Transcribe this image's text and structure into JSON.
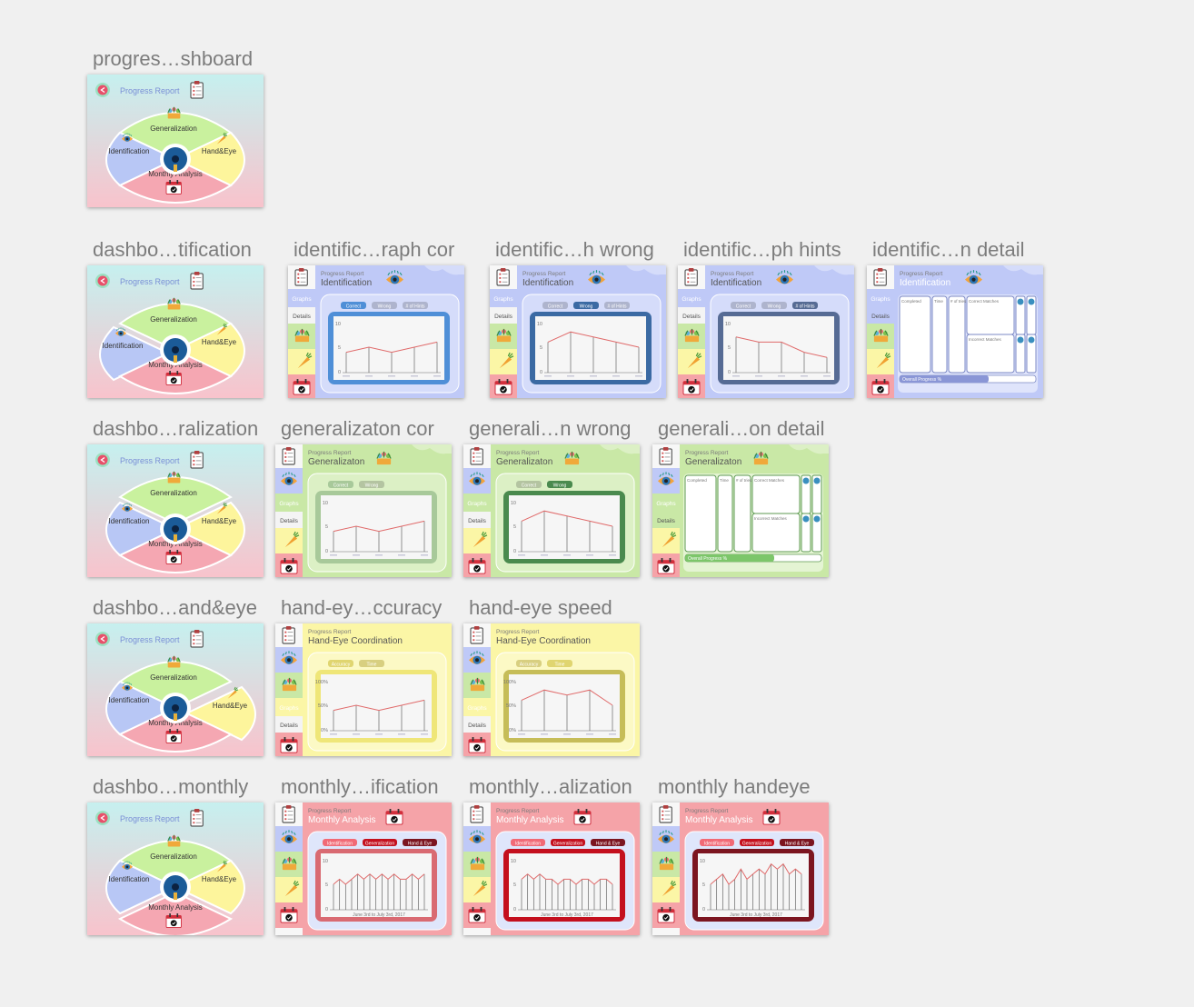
{
  "canvas_background": "#f0f0f0",
  "common": {
    "progress_report": "Progress Report",
    "graphs": "Graphs",
    "details": "Details",
    "correct": "Correct",
    "wrong": "Wrong",
    "hints": "# of Hints",
    "completed": "Completed",
    "time": "Time",
    "num_tries": "# of tries",
    "correct_matches": "Correct Matches",
    "incorrect_matches": "Incorrect Matches",
    "overall_progress": "Overall Progress %",
    "accuracy": "Accuracy",
    "time_tab": "Time",
    "identification_tab": "Identification",
    "generalization_tab": "Generalization",
    "hand_eye_tab": "Hand & Eye",
    "date_range": "June 3rd to July 3rd, 2017",
    "dash_generalization": "Generalization",
    "dash_identification": "Identification",
    "dash_handeye": "Hand&Eye",
    "dash_monthly": "Monthly Analysis",
    "y_max": "10",
    "y_mid": "5",
    "y_min": "0",
    "pct_100": "100%",
    "pct_50": "50%",
    "pct_0": "0%"
  },
  "colors": {
    "identification": "#bfc9f7",
    "generalization": "#c9e8a6",
    "handeye": "#fbf6a6",
    "monthly": "#f5a3a8",
    "dash_top": "#c6f0ef",
    "dash_bottom": "#f8c3cc"
  },
  "artboards": [
    {
      "name": "progres…shboard",
      "kind": "dashboard",
      "highlight": "none"
    },
    {
      "name": "dashbo…tification",
      "kind": "dashboard",
      "highlight": "identification"
    },
    {
      "name": "identific…raph cor",
      "kind": "graph",
      "section": "identification",
      "title": "Identification",
      "active_tab": 0,
      "frame": "#4f8fd7",
      "points": [
        4,
        5,
        4,
        5,
        6
      ]
    },
    {
      "name": "identific…h wrong",
      "kind": "graph",
      "section": "identification",
      "title": "Identification",
      "active_tab": 1,
      "frame": "#3b6aa3",
      "points": [
        6,
        8,
        7,
        6,
        5
      ]
    },
    {
      "name": "identific…ph hints",
      "kind": "graph",
      "section": "identification",
      "title": "Identification",
      "active_tab": 2,
      "frame": "#566b94",
      "points": [
        7,
        6,
        6,
        4,
        3
      ]
    },
    {
      "name": "identific…n detail",
      "kind": "detail",
      "section": "identification",
      "title": "Identification"
    },
    {
      "name": "dashbo…ralization",
      "kind": "dashboard",
      "highlight": "generalization"
    },
    {
      "name": "generalizaton cor",
      "kind": "graph",
      "section": "generalization",
      "title": "Generalizaton",
      "active_tab": 0,
      "frame": "#a8c99a",
      "points": [
        4,
        5,
        4,
        5,
        6
      ]
    },
    {
      "name": "generali…n wrong",
      "kind": "graph",
      "section": "generalization",
      "title": "Generalizaton",
      "active_tab": 1,
      "frame": "#4a8a4e",
      "points": [
        6,
        8,
        7,
        6,
        5
      ]
    },
    {
      "name": "generali…on detail",
      "kind": "detail",
      "section": "generalization",
      "title": "Generalizaton"
    },
    {
      "name": "dashbo…and&eye",
      "kind": "dashboard",
      "highlight": "handeye"
    },
    {
      "name": "hand-ey…ccuracy",
      "kind": "graph",
      "section": "handeye",
      "title": "Hand-Eye Coordination",
      "active_tab": 0,
      "frame": "#efe678",
      "points": [
        4,
        5,
        4,
        5,
        6
      ]
    },
    {
      "name": "hand-eye speed",
      "kind": "graph",
      "section": "handeye",
      "title": "Hand-Eye Coordination",
      "active_tab": 1,
      "frame": "#c6bd58",
      "points": [
        6,
        8,
        7,
        8,
        5
      ]
    },
    {
      "name": "dashbo…monthly",
      "kind": "dashboard",
      "highlight": "monthly"
    },
    {
      "name": "monthly…ification",
      "kind": "graph",
      "section": "monthly",
      "title": "Monthly Analysis",
      "active_tab": 0,
      "frame": "#d96a72",
      "points": [
        5,
        6,
        5,
        6,
        7,
        6,
        7,
        6,
        7,
        6,
        7,
        6,
        6,
        7,
        6,
        7
      ]
    },
    {
      "name": "monthly…alization",
      "kind": "graph",
      "section": "monthly",
      "title": "Monthly Analysis",
      "active_tab": 1,
      "frame": "#c4101e",
      "points": [
        6,
        7,
        6,
        7,
        6,
        6,
        5,
        6,
        6,
        5,
        6,
        6,
        5,
        6,
        6,
        5
      ]
    },
    {
      "name": "monthly handeye",
      "kind": "graph",
      "section": "monthly",
      "title": "Monthly Analysis",
      "active_tab": 2,
      "frame": "#7c1520",
      "points": [
        5,
        6,
        7,
        5,
        6,
        8,
        6,
        7,
        8,
        7,
        9,
        8,
        9,
        7,
        8,
        7
      ]
    }
  ]
}
